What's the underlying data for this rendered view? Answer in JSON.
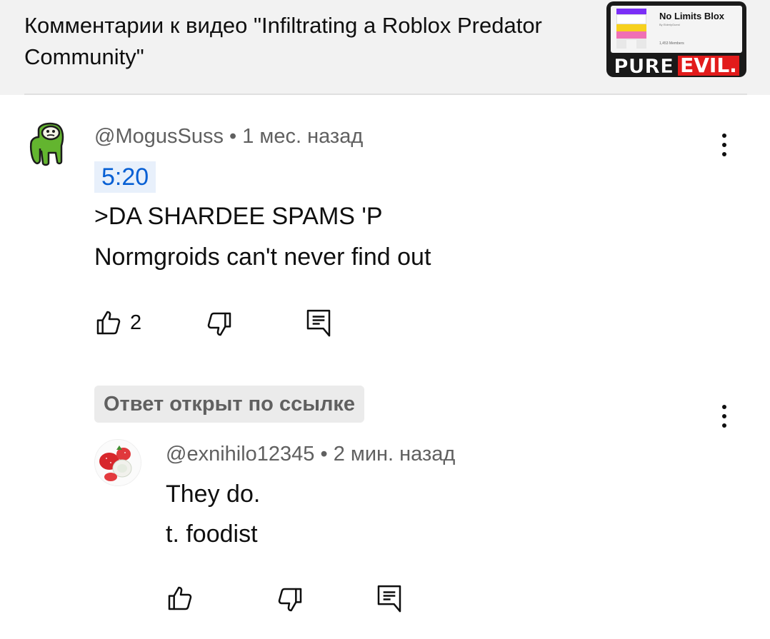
{
  "header": {
    "title": "Комментарии к видео \"Infiltrating a Roblox Predator Community\"",
    "thumbnail": {
      "group_name": "No Limits Blox",
      "group_subtext": "By ElderlyGuest",
      "members": "1,453 Members",
      "overlay_pure": "PURE",
      "overlay_evil": "EVIL."
    }
  },
  "comment": {
    "author": "@MogusSuss",
    "separator": "•",
    "time": "1 мес. назад",
    "timestamp_link": "5:20",
    "lines": [
      ">DA SHARDEE SPAMS 'P",
      "Normgroids can't never find out"
    ],
    "likes": "2",
    "avatar_icon": "green-amogus-avatar-icon"
  },
  "reply": {
    "linked_badge": "Ответ открыт по ссылке",
    "author": "@exnihilo12345",
    "separator": "•",
    "time": "2 мин. назад",
    "lines": [
      "They do.",
      "t. foodist"
    ],
    "avatar_icon": "strawberry-avatar-icon"
  },
  "colors": {
    "header_bg": "#f2f2f2",
    "link_blue": "#065fd4",
    "link_chip_bg": "#e8f0fb",
    "secondary_text": "#606060"
  }
}
